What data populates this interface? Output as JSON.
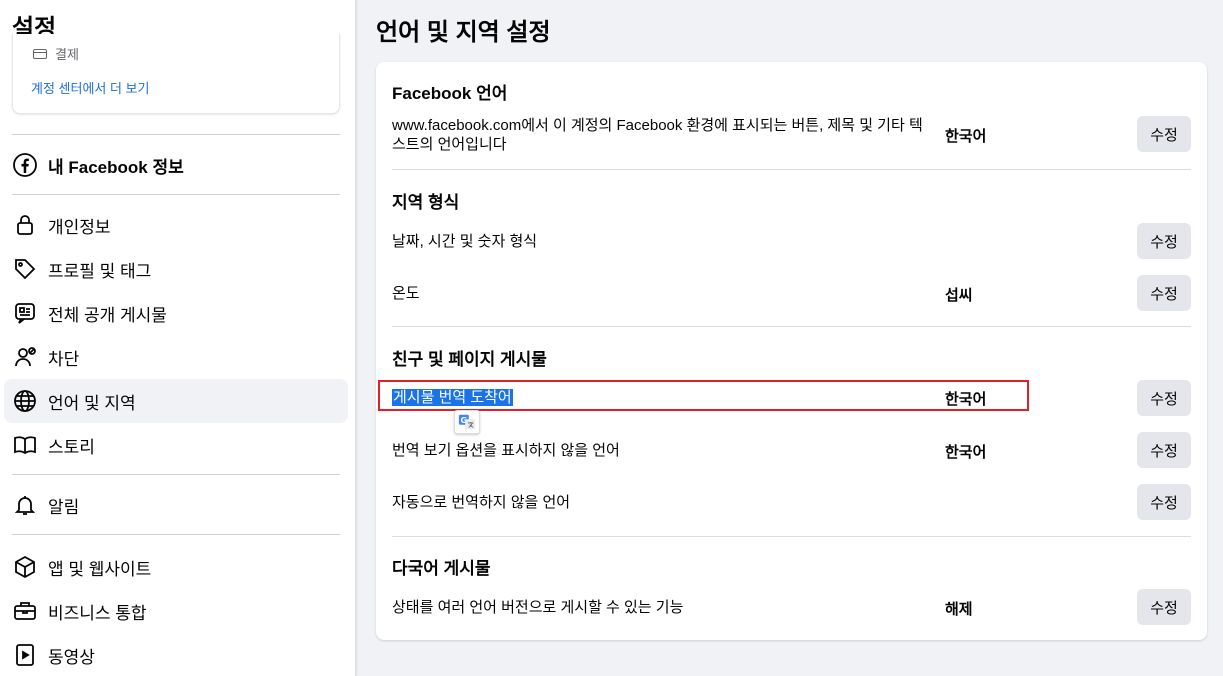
{
  "sidebar": {
    "title": "설정",
    "account_card": {
      "payment_label": "결제",
      "more_link": "계정 센터에서 더 보기"
    },
    "items": [
      {
        "label_bold": "내 Facebook 정보",
        "icon": "facebook-logo-icon"
      },
      {
        "label": "개인정보",
        "icon": "lock-icon"
      },
      {
        "label": "프로필 및 태그",
        "icon": "tag-icon"
      },
      {
        "label": "전체 공개 게시물",
        "icon": "public-post-icon"
      },
      {
        "label": "차단",
        "icon": "block-user-icon"
      },
      {
        "label": "언어 및 지역",
        "icon": "globe-icon",
        "active": true
      },
      {
        "label": "스토리",
        "icon": "book-icon"
      },
      {
        "label": "알림",
        "icon": "bell-icon"
      },
      {
        "label": "앱 및 웹사이트",
        "icon": "cube-icon"
      },
      {
        "label": "비즈니스 통합",
        "icon": "briefcase-icon"
      },
      {
        "label": "동영상",
        "icon": "video-icon"
      }
    ]
  },
  "main": {
    "title": "언어 및 지역 설정",
    "edit_label": "수정",
    "sections": [
      {
        "title": "Facebook 언어",
        "rows": [
          {
            "label": "www.facebook.com에서 이 계정의 Facebook 환경에 표시되는 버튼, 제목 및 기타 텍스트의 언어입니다",
            "value": "한국어"
          }
        ]
      },
      {
        "title": "지역 형식",
        "rows": [
          {
            "label": "날짜, 시간 및 숫자 형식",
            "value": ""
          },
          {
            "label": "온도",
            "value": "섭씨"
          }
        ]
      },
      {
        "title": "친구 및 페이지 게시물",
        "rows": [
          {
            "label": "게시물 번역 도착어",
            "value": "한국어"
          },
          {
            "label": "번역 보기 옵션을 표시하지 않을 언어",
            "value": "한국어"
          },
          {
            "label": "자동으로 번역하지 않을 언어",
            "value": ""
          }
        ]
      },
      {
        "title": "다국어 게시물",
        "rows": [
          {
            "label": "상태를 여러 언어 버전으로 게시할 수 있는 기능",
            "value": "해제"
          }
        ]
      }
    ]
  },
  "colors": {
    "background": "#f0f2f5",
    "link": "#216fdb",
    "button": "#e4e6eb",
    "highlight_border": "#e41e26",
    "selection": "#1a73e8"
  }
}
